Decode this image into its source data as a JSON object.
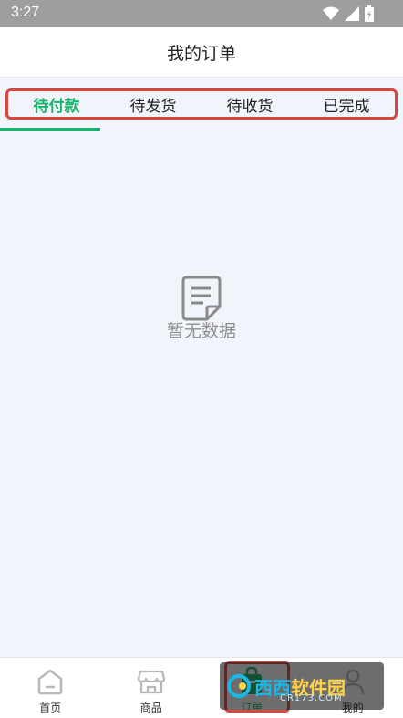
{
  "status_bar": {
    "time": "3:27"
  },
  "header": {
    "title": "我的订单"
  },
  "tabs": [
    {
      "label": "待付款",
      "active": true
    },
    {
      "label": "待发货",
      "active": false
    },
    {
      "label": "待收货",
      "active": false
    },
    {
      "label": "已完成",
      "active": false
    }
  ],
  "empty_state": {
    "text": "暂无数据",
    "icon": "document-icon"
  },
  "bottom_nav": {
    "items": [
      {
        "label": "首页",
        "icon": "home-icon"
      },
      {
        "label": "商品",
        "icon": "shop-icon"
      },
      {
        "label": "订单",
        "icon": "order-bag-icon",
        "active": true
      },
      {
        "label": "我的",
        "icon": "user-icon"
      }
    ]
  },
  "watermark": {
    "brand": "西西",
    "brand_rest": "软件园",
    "sub": "CR173.COM"
  },
  "colors": {
    "accent": "#19b46b",
    "highlight": "#d9463e",
    "background": "#f2f4fb",
    "status_bar": "#9e9e9e"
  }
}
